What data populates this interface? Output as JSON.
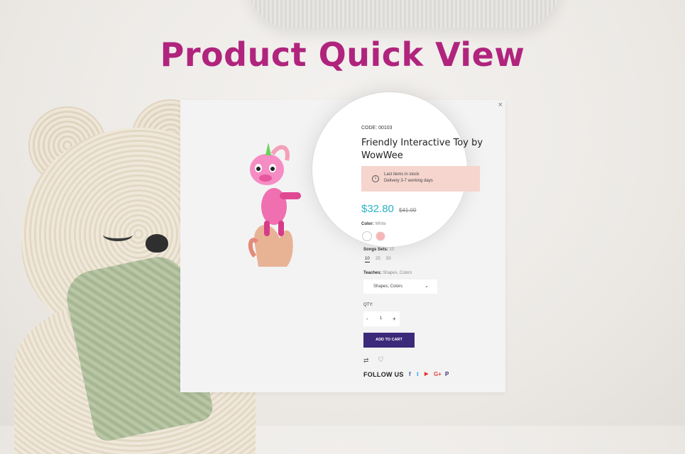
{
  "page": {
    "title": "Product Quick View"
  },
  "modal": {
    "close_glyph": "×",
    "code": "CODE: 00103",
    "title": "Friendly Interactive Toy by WowWee",
    "stock": {
      "line1": "Last items in stock",
      "line2": "Delivery 3-7 working days"
    },
    "price": "$32.80",
    "old_price": "$41.00",
    "color": {
      "label": "Color:",
      "value": "White",
      "swatches": [
        "#ffffff",
        "#f4b6b6"
      ]
    },
    "songs": {
      "label": "Songs Sets:",
      "value": "10",
      "options": [
        "10",
        "25",
        "50"
      ]
    },
    "teaches": {
      "label": "Teaches:",
      "value": "Shapes, Colors",
      "selected": "Shapes, Colors"
    },
    "qty": {
      "label": "QTY:",
      "value": "1",
      "minus": "-",
      "plus": "+"
    },
    "add_to_cart": "ADD TO CART",
    "follow_us": "FOLLOW US",
    "social": [
      {
        "name": "facebook-icon",
        "glyph": "f",
        "color": "#3b5998"
      },
      {
        "name": "twitter-icon",
        "glyph": "t",
        "color": "#1da1f2"
      },
      {
        "name": "youtube-icon",
        "glyph": "▶",
        "color": "#e52d27"
      },
      {
        "name": "google-plus-icon",
        "glyph": "G+",
        "color": "#dd4b39"
      },
      {
        "name": "pinterest-icon",
        "glyph": "P",
        "color": "#3b2a7a"
      }
    ]
  }
}
